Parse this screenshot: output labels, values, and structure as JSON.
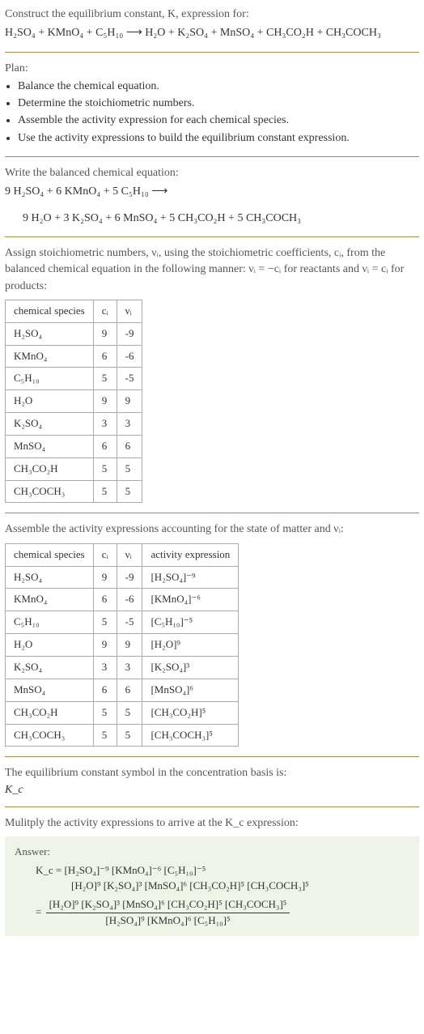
{
  "intro": "Construct the equilibrium constant, K, expression for:",
  "main_equation": "H₂SO₄ + KMnO₄ + C₅H₁₀ ⟶ H₂O + K₂SO₄ + MnSO₄ + CH₃CO₂H + CH₃COCH₃",
  "plan_label": "Plan:",
  "plan": [
    "Balance the chemical equation.",
    "Determine the stoichiometric numbers.",
    "Assemble the activity expression for each chemical species.",
    "Use the activity expressions to build the equilibrium constant expression."
  ],
  "balanced_label": "Write the balanced chemical equation:",
  "balanced_lhs": "9 H₂SO₄ + 6 KMnO₄ + 5 C₅H₁₀ ⟶",
  "balanced_rhs": "9 H₂O + 3 K₂SO₄ + 6 MnSO₄ + 5 CH₃CO₂H + 5 CH₃COCH₃",
  "assign_text": "Assign stoichiometric numbers, νᵢ, using the stoichiometric coefficients, cᵢ, from the balanced chemical equation in the following manner: νᵢ = −cᵢ for reactants and νᵢ = cᵢ for products:",
  "table1": {
    "headers": [
      "chemical species",
      "cᵢ",
      "νᵢ"
    ],
    "rows": [
      [
        "H₂SO₄",
        "9",
        "-9"
      ],
      [
        "KMnO₄",
        "6",
        "-6"
      ],
      [
        "C₅H₁₀",
        "5",
        "-5"
      ],
      [
        "H₂O",
        "9",
        "9"
      ],
      [
        "K₂SO₄",
        "3",
        "3"
      ],
      [
        "MnSO₄",
        "6",
        "6"
      ],
      [
        "CH₃CO₂H",
        "5",
        "5"
      ],
      [
        "CH₃COCH₃",
        "5",
        "5"
      ]
    ]
  },
  "assemble_text": "Assemble the activity expressions accounting for the state of matter and νᵢ:",
  "table2": {
    "headers": [
      "chemical species",
      "cᵢ",
      "νᵢ",
      "activity expression"
    ],
    "rows": [
      [
        "H₂SO₄",
        "9",
        "-9",
        "[H₂SO₄]⁻⁹"
      ],
      [
        "KMnO₄",
        "6",
        "-6",
        "[KMnO₄]⁻⁶"
      ],
      [
        "C₅H₁₀",
        "5",
        "-5",
        "[C₅H₁₀]⁻⁵"
      ],
      [
        "H₂O",
        "9",
        "9",
        "[H₂O]⁹"
      ],
      [
        "K₂SO₄",
        "3",
        "3",
        "[K₂SO₄]³"
      ],
      [
        "MnSO₄",
        "6",
        "6",
        "[MnSO₄]⁶"
      ],
      [
        "CH₃CO₂H",
        "5",
        "5",
        "[CH₃CO₂H]⁵"
      ],
      [
        "CH₃COCH₃",
        "5",
        "5",
        "[CH₃COCH₃]⁵"
      ]
    ]
  },
  "eq_const_text": "The equilibrium constant symbol in the concentration basis is:",
  "kc": "K_c",
  "multiply_text": "Mulitply the activity expressions to arrive at the K_c expression:",
  "answer_label": "Answer:",
  "answer_line1a": "K_c = [H₂SO₄]⁻⁹ [KMnO₄]⁻⁶ [C₅H₁₀]⁻⁵",
  "answer_line1b": "[H₂O]⁹ [K₂SO₄]³ [MnSO₄]⁶ [CH₃CO₂H]⁵ [CH₃COCH₃]⁵",
  "answer_frac_num": "[H₂O]⁹ [K₂SO₄]³ [MnSO₄]⁶ [CH₃CO₂H]⁵ [CH₃COCH₃]⁵",
  "answer_frac_den": "[H₂SO₄]⁹ [KMnO₄]⁶ [C₅H₁₀]⁵",
  "chart_data": {
    "type": "table",
    "title": "Stoichiometric numbers and activity expressions",
    "tables": [
      {
        "headers": [
          "chemical species",
          "c_i",
          "ν_i"
        ],
        "rows": [
          {
            "species": "H2SO4",
            "c": 9,
            "nu": -9
          },
          {
            "species": "KMnO4",
            "c": 6,
            "nu": -6
          },
          {
            "species": "C5H10",
            "c": 5,
            "nu": -5
          },
          {
            "species": "H2O",
            "c": 9,
            "nu": 9
          },
          {
            "species": "K2SO4",
            "c": 3,
            "nu": 3
          },
          {
            "species": "MnSO4",
            "c": 6,
            "nu": 6
          },
          {
            "species": "CH3CO2H",
            "c": 5,
            "nu": 5
          },
          {
            "species": "CH3COCH3",
            "c": 5,
            "nu": 5
          }
        ]
      },
      {
        "headers": [
          "chemical species",
          "c_i",
          "ν_i",
          "activity expression"
        ],
        "rows": [
          {
            "species": "H2SO4",
            "c": 9,
            "nu": -9,
            "activity": "[H2SO4]^-9"
          },
          {
            "species": "KMnO4",
            "c": 6,
            "nu": -6,
            "activity": "[KMnO4]^-6"
          },
          {
            "species": "C5H10",
            "c": 5,
            "nu": -5,
            "activity": "[C5H10]^-5"
          },
          {
            "species": "H2O",
            "c": 9,
            "nu": 9,
            "activity": "[H2O]^9"
          },
          {
            "species": "K2SO4",
            "c": 3,
            "nu": 3,
            "activity": "[K2SO4]^3"
          },
          {
            "species": "MnSO4",
            "c": 6,
            "nu": 6,
            "activity": "[MnSO4]^6"
          },
          {
            "species": "CH3CO2H",
            "c": 5,
            "nu": 5,
            "activity": "[CH3CO2H]^5"
          },
          {
            "species": "CH3COCH3",
            "c": 5,
            "nu": 5,
            "activity": "[CH3COCH3]^5"
          }
        ]
      }
    ]
  }
}
